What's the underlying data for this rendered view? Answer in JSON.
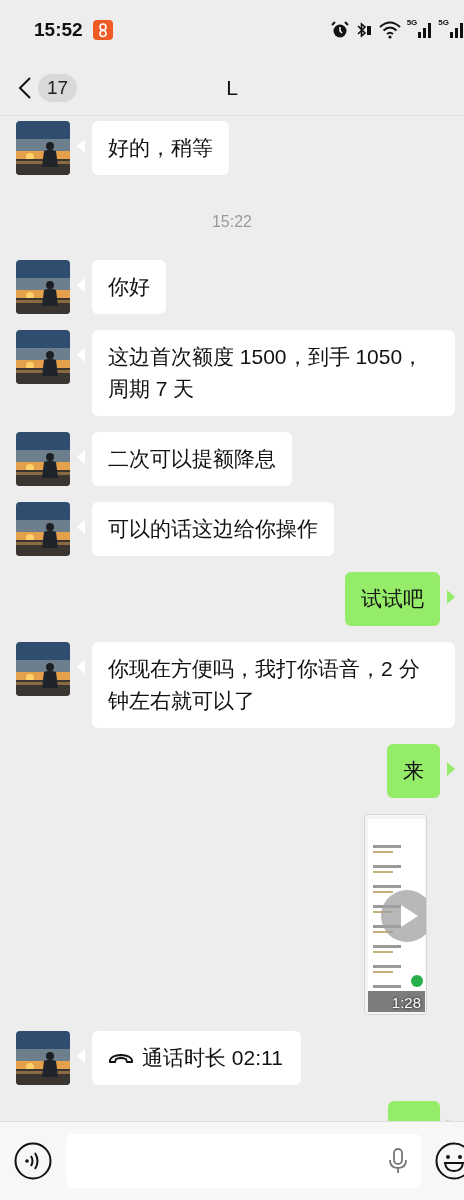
{
  "status_bar": {
    "time": "15:52",
    "network_labels": [
      "5G",
      "5G"
    ]
  },
  "header": {
    "back_count": "17",
    "title": "L"
  },
  "messages": [
    {
      "kind": "text",
      "sent": false,
      "text": "好的，稍等"
    },
    {
      "kind": "time",
      "text": "15:22"
    },
    {
      "kind": "text",
      "sent": false,
      "text": "你好"
    },
    {
      "kind": "text",
      "sent": false,
      "text": "这边首次额度 1500，到手 1050，周期 7 天"
    },
    {
      "kind": "text",
      "sent": false,
      "text": "二次可以提额降息"
    },
    {
      "kind": "text",
      "sent": false,
      "text": "可以的话这边给你操作"
    },
    {
      "kind": "text",
      "sent": true,
      "text": "试试吧"
    },
    {
      "kind": "text",
      "sent": false,
      "text": "你现在方便吗，我打你语音，2 分钟左右就可以了"
    },
    {
      "kind": "text",
      "sent": true,
      "text": "来"
    },
    {
      "kind": "video",
      "sent": true,
      "duration": "1:28"
    },
    {
      "kind": "call",
      "sent": false,
      "text": "通话时长 02:11"
    },
    {
      "kind": "text",
      "sent": true
    }
  ]
}
